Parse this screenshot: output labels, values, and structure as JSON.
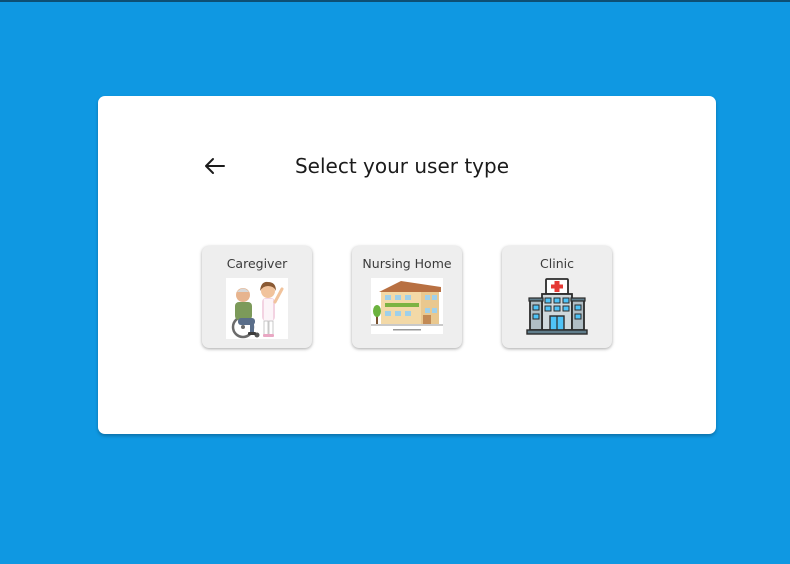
{
  "page": {
    "title": "Select your user type",
    "background_color": "#0f98e2"
  },
  "back_button": {
    "icon": "arrow-left-icon"
  },
  "user_types": [
    {
      "label": "Caregiver",
      "icon": "caregiver-wheelchair-illustration"
    },
    {
      "label": "Nursing Home",
      "icon": "nursing-home-building-illustration"
    },
    {
      "label": "Clinic",
      "icon": "clinic-hospital-icon"
    }
  ]
}
